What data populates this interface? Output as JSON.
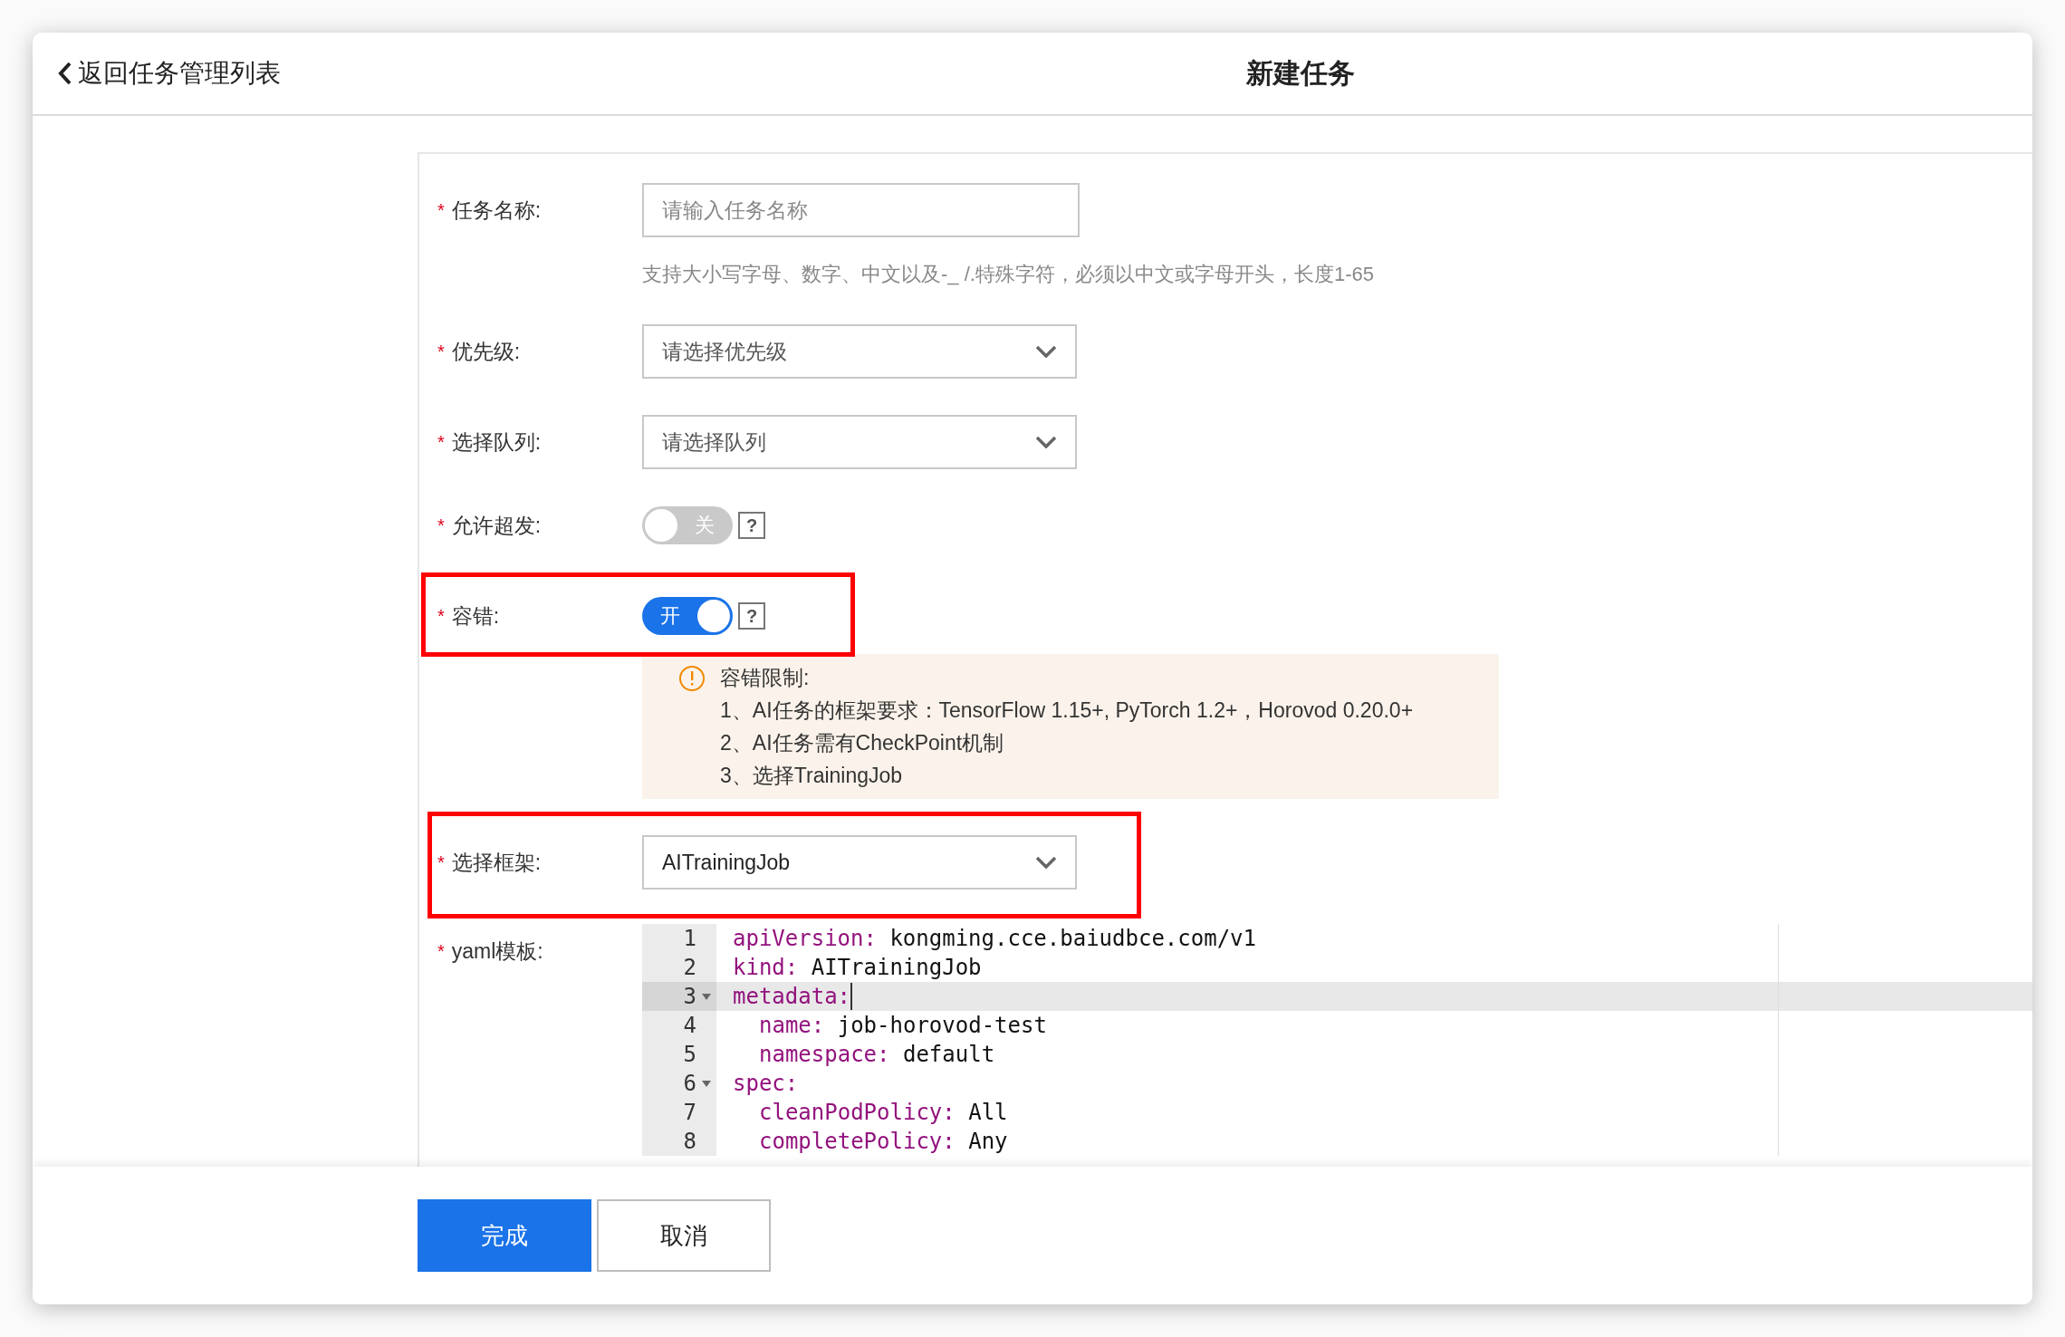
{
  "header": {
    "back_link": "返回任务管理列表",
    "title": "新建任务"
  },
  "form": {
    "rows": [
      {
        "kind": "input",
        "label": "任务名称:",
        "required_mark": "*",
        "placeholder": "请输入任务名称",
        "hint": "支持大小写字母、数字、中文以及-_ /.特殊字符，必须以中文或字母开头，长度1-65",
        "highlighted": false
      },
      {
        "kind": "select",
        "label": "优先级:",
        "required_mark": "*",
        "placeholder": "请选择优先级",
        "highlighted": false
      },
      {
        "kind": "select",
        "label": "选择队列:",
        "required_mark": "*",
        "placeholder": "请选择队列",
        "highlighted": false
      },
      {
        "kind": "switch",
        "label": "允许超发:",
        "required_mark": "*",
        "on": false,
        "text": "关",
        "help": "?",
        "highlighted": false
      },
      {
        "kind": "switch",
        "label": "容错:",
        "required_mark": "*",
        "on": true,
        "text": "开",
        "help": "?",
        "highlighted": true,
        "notice": {
          "title": "容错限制:",
          "lines": [
            "1、AI任务的框架要求：TensorFlow 1.15+, PyTorch 1.2+，Horovod 0.20.0+",
            "2、AI任务需有CheckPoint机制",
            "3、选择TrainingJob"
          ]
        }
      },
      {
        "kind": "select",
        "label": "选择框架:",
        "required_mark": "*",
        "value": "AITrainingJob",
        "highlighted": true
      },
      {
        "kind": "code",
        "label": "yaml模板:",
        "required_mark": "*",
        "lines": [
          {
            "number": "1",
            "key": "apiVersion:",
            "value": "kongming.cce.baiudbce.com/v1",
            "active": false
          },
          {
            "number": "2",
            "key": "kind:",
            "value": "AITrainingJob",
            "active": false
          },
          {
            "number": "3",
            "key": "metadata:",
            "active": true,
            "expanded": true,
            "children": [
              {
                "number": "4",
                "key": "name:",
                "value": "job-horovod-test",
                "active": false
              },
              {
                "number": "5",
                "key": "namespace:",
                "value": "default",
                "active": false
              }
            ]
          },
          {
            "number": "6",
            "key": "spec:",
            "active": false,
            "expanded": true,
            "children": [
              {
                "number": "7",
                "key": "cleanPodPolicy:",
                "value": "All",
                "active": false
              },
              {
                "number": "8",
                "key": "completePolicy:",
                "value": "Any",
                "active": false
              }
            ]
          }
        ]
      }
    ]
  },
  "footer": {
    "buttons": [
      {
        "label": "完成",
        "kind": "primary"
      },
      {
        "label": "取消",
        "kind": "default"
      }
    ]
  }
}
